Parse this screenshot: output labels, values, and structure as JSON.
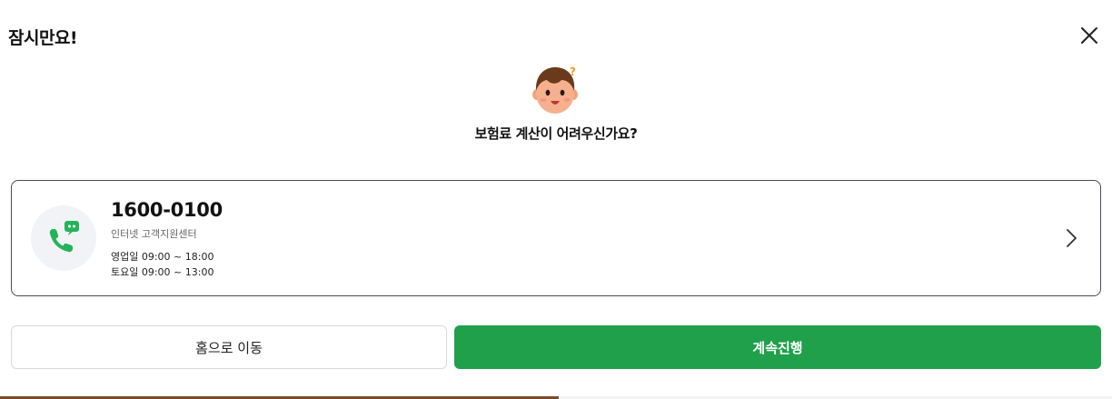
{
  "modal": {
    "title": "잠시만요!",
    "question": "보험료 계산이 어려우신가요?",
    "close_icon": "close-icon",
    "avatar_icon": "confused-face-avatar"
  },
  "contact": {
    "phone": "1600-0100",
    "center": "인터넷 고객지원센터",
    "hours_weekday": "영업일 09:00 ~ 18:00",
    "hours_saturday": "토요일 09:00 ~ 13:00",
    "icon": "phone-chat-icon",
    "arrow_icon": "chevron-right-icon"
  },
  "buttons": {
    "home": "홈으로 이동",
    "continue": "계속진행"
  },
  "colors": {
    "accent": "#20a04a",
    "card_border": "#4a4a5a",
    "icon_bg": "#f1f3f6"
  }
}
